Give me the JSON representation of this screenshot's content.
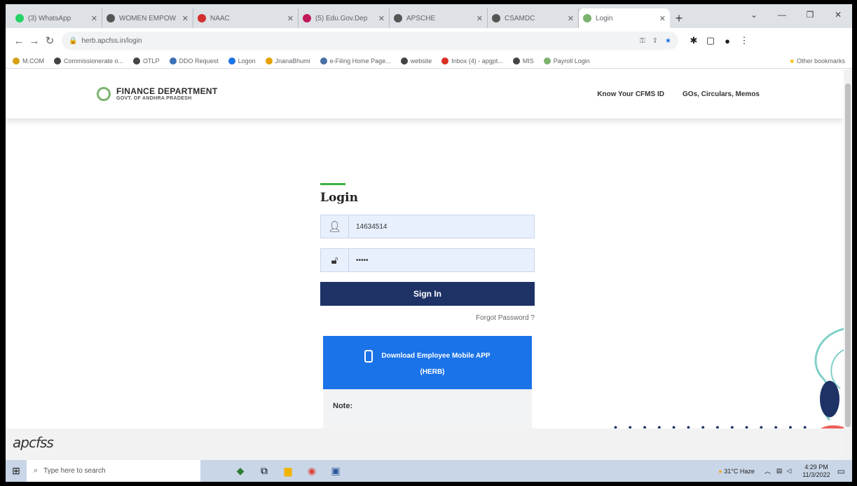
{
  "browser": {
    "tabs": [
      {
        "label": "(3) WhatsApp",
        "color": "#25d366"
      },
      {
        "label": "WOMEN EMPOW",
        "color": "#555"
      },
      {
        "label": "NAAC",
        "color": "#d32f2f"
      },
      {
        "label": "(5) Edu.Gov.Dep",
        "color": "#c2185b"
      },
      {
        "label": "APSCHE",
        "color": "#555"
      },
      {
        "label": "CSAMDC",
        "color": "#555"
      },
      {
        "label": "Login",
        "color": "#7cb36f"
      }
    ],
    "url": "herb.apcfss.in/login",
    "bookmarks": [
      "M.COM",
      "Commissionerate o...",
      "OTLP",
      "DDO Request",
      "Logon",
      "JnanaBhumi",
      "e-Filing Home Page...",
      "website",
      "Inbox (4) - apgpt...",
      "MIS",
      "Payroll Login"
    ],
    "other_bookmarks": "Other bookmarks"
  },
  "header": {
    "logo_line1": "FINANCE DEPARTMENT",
    "logo_line2": "GOVT. OF ANDHRA PRADESH",
    "nav": [
      "Know Your CFMS ID",
      "GOs, Circulars, Memos"
    ]
  },
  "login": {
    "title": "Login",
    "username_value": "14634514",
    "password_value": "•••••",
    "signin_label": "Sign In",
    "forgot_label": "Forgot Password ?"
  },
  "app_banner": {
    "line1": "Download Employee Mobile APP",
    "line2": "(HERB)"
  },
  "note": {
    "label": "Note:"
  },
  "footer": {
    "brand": "apcfss"
  },
  "taskbar": {
    "search_placeholder": "Type here to search",
    "weather": "31°C Haze",
    "time": "4:29 PM",
    "date": "11/3/2022"
  }
}
